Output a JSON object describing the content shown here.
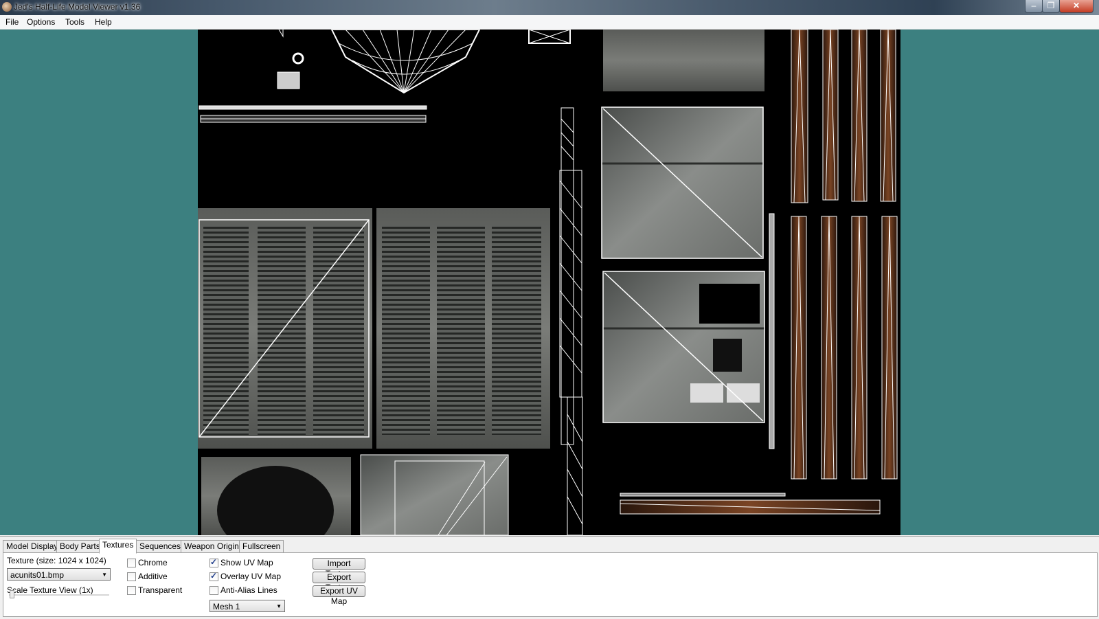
{
  "window": {
    "title": "Jed's Half-Life Model Viewer v1.36",
    "app_icon": "hl-app-icon",
    "controls": {
      "minimize": "–",
      "maximize": "❐",
      "close": "✕"
    }
  },
  "menu": {
    "file": "File",
    "options": "Options",
    "tools": "Tools",
    "help": "Help"
  },
  "colors": {
    "viewport_background": "#3c8080",
    "texture_background": "#000000",
    "uv_lines": "#ffffff",
    "metal": "#6e706c",
    "rust": "#6b3a1e"
  },
  "tabs": {
    "model_display": "Model Display",
    "body_parts": "Body Parts",
    "textures": "Textures",
    "sequences": "Sequences",
    "weapon_origin": "Weapon Origin",
    "fullscreen": "Fullscreen",
    "active": "Textures"
  },
  "texture_panel": {
    "size_label": "Texture (size: 1024 x 1024)",
    "selected_texture": "acunits01.bmp",
    "scale_label": "Scale Texture View (1x)",
    "scale_value": 1,
    "chrome": {
      "label": "Chrome",
      "checked": false
    },
    "additive": {
      "label": "Additive",
      "checked": false
    },
    "transparent": {
      "label": "Transparent",
      "checked": false
    },
    "show_uv_map": {
      "label": "Show UV Map",
      "checked": true
    },
    "overlay_uv_map": {
      "label": "Overlay UV Map",
      "checked": true
    },
    "anti_alias_lines": {
      "label": "Anti-Alias Lines",
      "checked": false
    },
    "selected_mesh": "Mesh 1",
    "import_texture": "Import Texture",
    "export_texture": "Export Texture",
    "export_uv_map": "Export UV Map"
  }
}
